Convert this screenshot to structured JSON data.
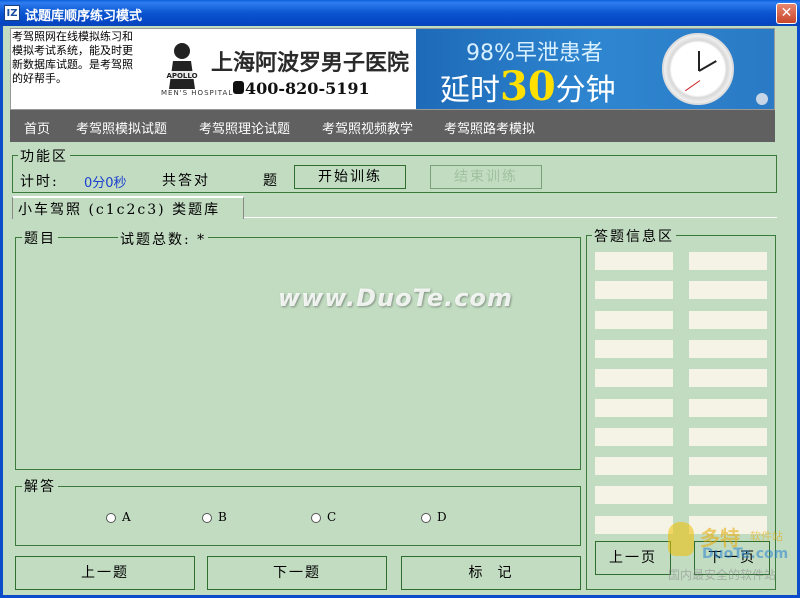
{
  "window": {
    "icon_text": "IZ",
    "title": "试题库顺序练习模式",
    "close_glyph": "✕"
  },
  "banner": {
    "intro": "考驾照网在线模拟练习和模拟考试系统，能及时更新数据库试题。是考驾照的好帮手。",
    "hospital_name": "上海阿波罗男子医院",
    "hospital_en": "MEN'S HOSPITAL",
    "phone": "400-820-5191",
    "ad_percent_text": "98%早泄患者",
    "ad_duration_prefix": "延时",
    "ad_duration_number": "30",
    "ad_duration_suffix": "分钟"
  },
  "nav": {
    "items": [
      "首页",
      "考驾照模拟试题",
      "考驾照理论试题",
      "考驾照视频教学",
      "考驾照路考模拟"
    ]
  },
  "function_area": {
    "label": "功能区",
    "timer_label": "计时:",
    "timer_value": "0分0秒",
    "answered_label": "共答对",
    "answered_count": "",
    "answered_unit": "题",
    "start_button": "开始训练",
    "end_button": "结束训练"
  },
  "tab": {
    "label": "小车驾照 (c1c2c3) 类题库"
  },
  "question_area": {
    "label": "题目",
    "total_label": "试题总数:",
    "total_value": "*"
  },
  "watermark": "www.DuoTe.com",
  "answer_area": {
    "label": "解答",
    "options": [
      "A",
      "B",
      "C",
      "D"
    ]
  },
  "bottom_buttons": {
    "prev_question": "上一题",
    "next_question": "下一题",
    "mark": "标  记"
  },
  "info_area": {
    "label": "答题信息区",
    "prev_page": "上一页",
    "next_page": "下一页"
  },
  "site_watermark": {
    "name": "多特",
    "suffix": "软件站",
    "domain": "DuoTe.com",
    "tagline": "国内最安全的软件站"
  },
  "colors": {
    "background": "#c2dcc2",
    "title_bar": "#0a55d0",
    "nav_bar": "#606060",
    "timer": "#1a3fcf",
    "answer_cell": "#f4f3e6"
  }
}
